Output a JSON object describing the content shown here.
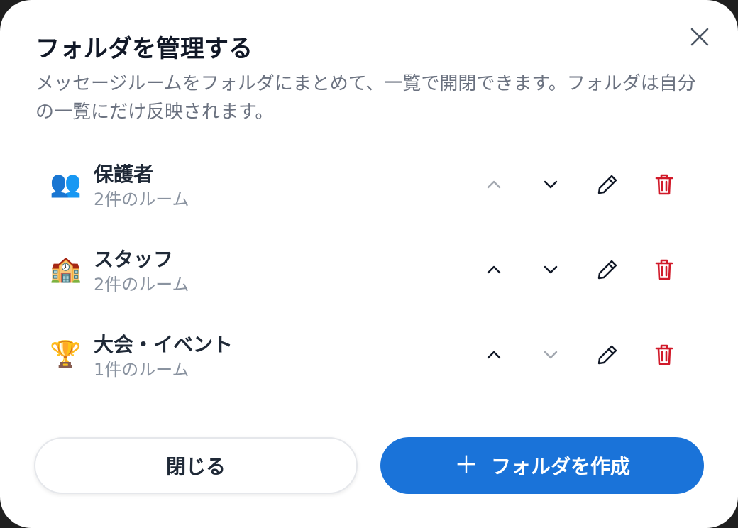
{
  "dialog": {
    "title": "フォルダを管理する",
    "description": "メッセージルームをフォルダにまとめて、一覧で開閉できます。フォルダは自分の一覧にだけ反映されます。",
    "close_icon": "close-icon"
  },
  "folders": [
    {
      "icon": "👥",
      "icon_name": "busts-in-silhouette-icon",
      "name": "保護者",
      "count": "2件のルーム",
      "move_up_enabled": false,
      "move_down_enabled": true
    },
    {
      "icon": "🏫",
      "icon_name": "school-icon",
      "name": "スタッフ",
      "count": "2件のルーム",
      "move_up_enabled": true,
      "move_down_enabled": true
    },
    {
      "icon": "🏆",
      "icon_name": "trophy-icon",
      "name": "大会・イベント",
      "count": "1件のルーム",
      "move_up_enabled": true,
      "move_down_enabled": false
    }
  ],
  "actions": {
    "close_label": "閉じる",
    "create_label": "フォルダを作成",
    "create_icon": "＋"
  },
  "colors": {
    "primary": "#1a73d9",
    "delete": "#d11a2a",
    "disabled": "#a3a8b0",
    "title_text": "#111827",
    "secondary_text": "#6b7280"
  }
}
